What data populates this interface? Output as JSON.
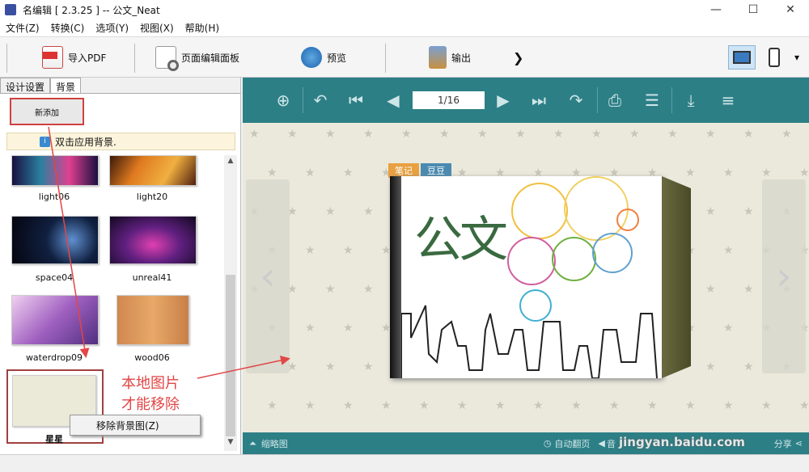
{
  "window": {
    "title": "名编辑 [       2.3.25 ] -- 公文_Neat",
    "min": "—",
    "max": "☐",
    "close": "✕"
  },
  "menu": [
    "文件(Z)",
    "转换(C)",
    "选项(Y)",
    "视图(X)",
    "帮助(H)"
  ],
  "toolbar": {
    "import_pdf": "导入PDF",
    "page_editor": "页面编辑面板",
    "preview": "预览",
    "output": "输出",
    "more": "❯",
    "dropdown": "▾"
  },
  "left_panel": {
    "tabs": [
      "设计设置",
      "背景"
    ],
    "add_button": "新添加",
    "hint": "双击应用背景.",
    "thumbnails": [
      "light06",
      "light20",
      "space04",
      "unreal41",
      "waterdrop09",
      "wood06",
      "星星"
    ],
    "context_menu": "移除背景图(Z)"
  },
  "viewer": {
    "page": "1/16",
    "tabs": [
      "笔记",
      "豆豆"
    ],
    "cover_title": "公文",
    "thumbnails_label": "缩略图",
    "autoplay_label": "自动翻页",
    "sound_label": "音",
    "share_label": "分享"
  },
  "annotation": {
    "line1": "本地图片",
    "line2": "才能移除"
  },
  "watermark": "jingyan.baidu.com",
  "colors": {
    "accent": "#2d7f86",
    "highlight": "#d04040",
    "annotation": "#e24646"
  }
}
